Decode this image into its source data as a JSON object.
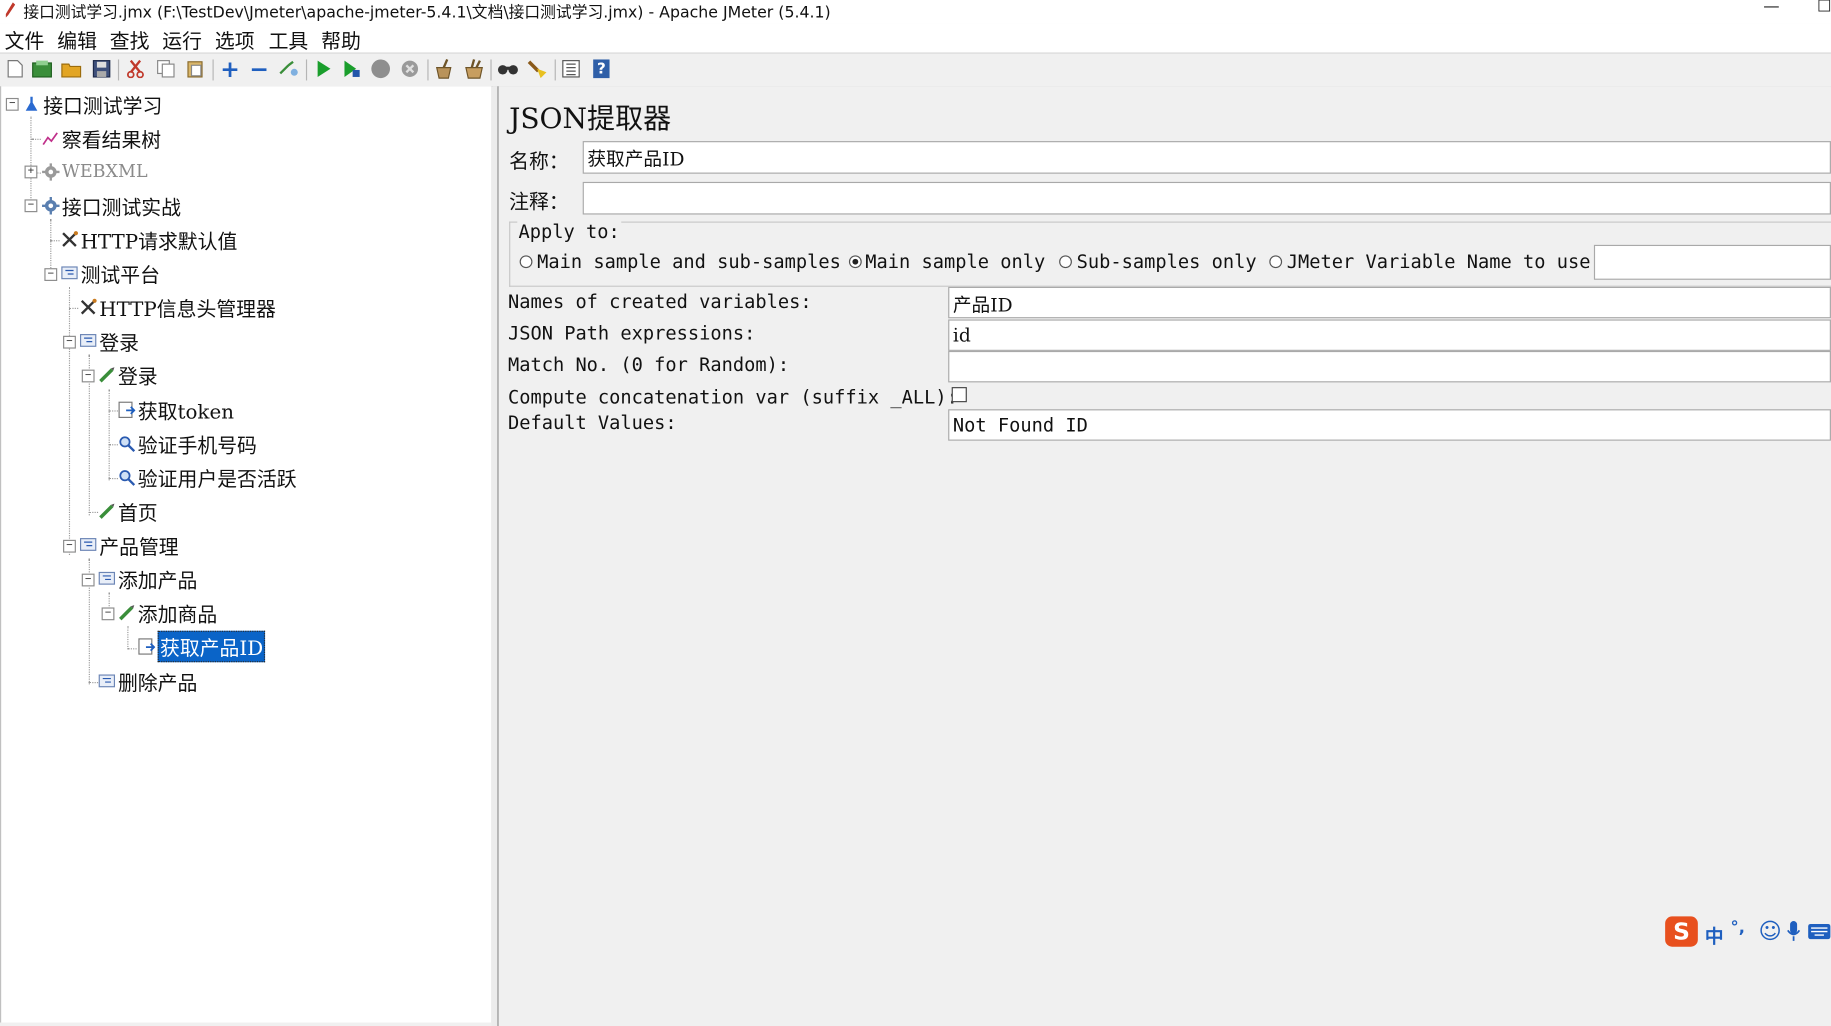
{
  "window": {
    "title": "接口测试学习.jmx (F:\\TestDev\\Jmeter\\apache-jmeter-5.4.1\\文档\\接口测试学习.jmx) - Apache JMeter (5.4.1)",
    "minimize_glyph": "—",
    "maximize_glyph": "☐"
  },
  "menu": [
    "文件",
    "编辑",
    "查找",
    "运行",
    "选项",
    "工具",
    "帮助"
  ],
  "toolbar": [
    {
      "icon": "new-icon"
    },
    {
      "icon": "templates-icon"
    },
    {
      "icon": "open-icon"
    },
    {
      "icon": "save-icon"
    },
    {
      "icon": "cut-icon"
    },
    {
      "icon": "copy-icon"
    },
    {
      "icon": "paste-icon"
    },
    {
      "icon": "expand-icon",
      "glyph": "+"
    },
    {
      "icon": "collapse-icon",
      "glyph": "−"
    },
    {
      "icon": "toggle-icon"
    },
    {
      "icon": "start-icon"
    },
    {
      "icon": "start-no-pauses-icon"
    },
    {
      "icon": "stop-icon"
    },
    {
      "icon": "shutdown-icon"
    },
    {
      "icon": "clear-icon"
    },
    {
      "icon": "clear-all-icon"
    },
    {
      "icon": "search-icon"
    },
    {
      "icon": "reset-search-icon"
    },
    {
      "icon": "function-helper-icon"
    },
    {
      "icon": "help-icon",
      "glyph": "?"
    }
  ],
  "tree": [
    {
      "label": "接口测试学习",
      "icon": "test-plan-icon"
    },
    {
      "label": "察看结果树",
      "icon": "listener-icon"
    },
    {
      "label": "WEBXML",
      "icon": "disabled-thread-group-icon",
      "disabled": true
    },
    {
      "label": "接口测试实战",
      "icon": "thread-group-icon"
    },
    {
      "label": "HTTP请求默认值",
      "icon": "config-element-icon"
    },
    {
      "label": "测试平台",
      "icon": "controller-icon"
    },
    {
      "label": "HTTP信息头管理器",
      "icon": "config-element-icon"
    },
    {
      "label": "登录",
      "icon": "controller-icon"
    },
    {
      "label": "登录",
      "icon": "sampler-icon"
    },
    {
      "label": "获取token",
      "icon": "extractor-icon"
    },
    {
      "label": "验证手机号码",
      "icon": "assertion-icon"
    },
    {
      "label": "验证用户是否活跃",
      "icon": "assertion-icon"
    },
    {
      "label": "首页",
      "icon": "sampler-icon"
    },
    {
      "label": "产品管理",
      "icon": "controller-icon"
    },
    {
      "label": "添加产品",
      "icon": "controller-icon"
    },
    {
      "label": "添加商品",
      "icon": "sampler-icon"
    },
    {
      "label": "获取产品ID",
      "icon": "extractor-icon",
      "selected": true
    },
    {
      "label": "删除产品",
      "icon": "controller-icon"
    }
  ],
  "expander": {
    "collapse": "−",
    "expand": "+"
  },
  "panel": {
    "title": "JSON提取器",
    "name_label": "名称：",
    "name_value": "获取产品ID",
    "comment_label": "注释：",
    "comment_value": "",
    "apply_to_label": "Apply to:",
    "apply_options": [
      {
        "label": "Main sample and sub-samples",
        "checked": false
      },
      {
        "label": "Main sample only",
        "checked": true
      },
      {
        "label": "Sub-samples only",
        "checked": false
      },
      {
        "label": "JMeter Variable Name to use",
        "checked": false
      }
    ],
    "variable_name_value": "",
    "fields": [
      {
        "label": "Names of created variables:",
        "value": "产品ID"
      },
      {
        "label": "JSON Path expressions:",
        "value": "id"
      },
      {
        "label": "Match No. (0 for Random):",
        "value": ""
      },
      {
        "label": "Compute concatenation var (suffix _ALL):",
        "checkbox": true,
        "checked": false
      },
      {
        "label": "Default Values:",
        "value": "Not Found ID"
      }
    ]
  },
  "ime": {
    "brand": "S",
    "mode": "中",
    "punct": "°,",
    "emoji": "☺",
    "mic": "mic-icon",
    "keyboard": "keyboard-icon"
  },
  "colors": {
    "selection": "#0a64c8",
    "panel_bg": "#f0f0f0",
    "play_green": "#1a9e2c"
  }
}
